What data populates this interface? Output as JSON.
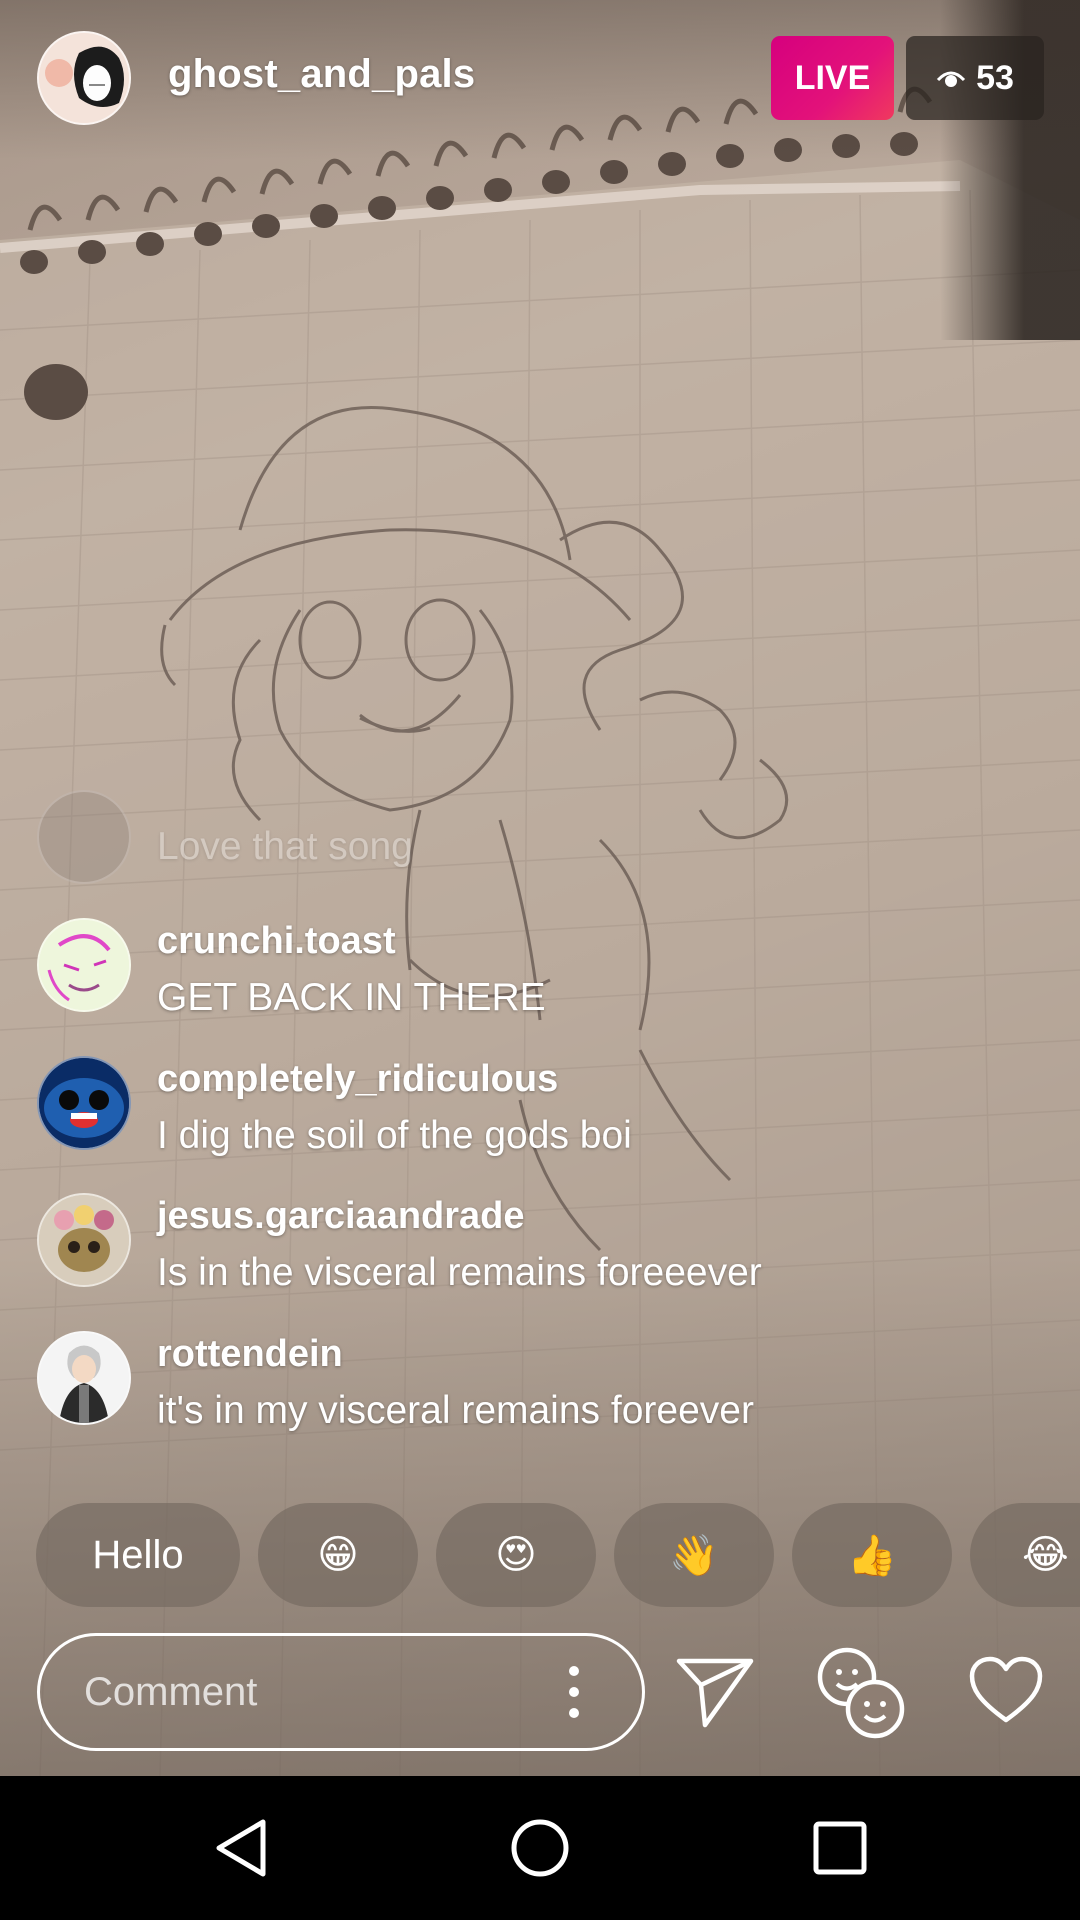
{
  "header": {
    "host_username": "ghost_and_pals",
    "live_label": "LIVE",
    "viewer_count": "53"
  },
  "comments": [
    {
      "username": "",
      "text": "Love that song"
    },
    {
      "username": "crunchi.toast",
      "text": "GET BACK IN THERE"
    },
    {
      "username": "completely_ridiculous",
      "text": "I dig the soil of the gods boi"
    },
    {
      "username": "jesus.garciaandrade",
      "text": "Is in the visceral remains foreeever"
    },
    {
      "username": "rottendein",
      "text": "it's in my visceral remains foreever"
    }
  ],
  "quick_replies": [
    "Hello",
    "😁",
    "😍",
    "👋",
    "👍",
    "😂"
  ],
  "comment_bar": {
    "placeholder": "Comment"
  },
  "colors": {
    "live_badge": "#e3127a",
    "text": "#ffffff"
  },
  "icons": {
    "viewer": "eye-icon",
    "send": "paper-plane-icon",
    "face_filter": "faces-icon",
    "like": "heart-icon",
    "more": "more-vertical-icon",
    "nav_back": "triangle-back-icon",
    "nav_home": "circle-home-icon",
    "nav_recents": "square-recents-icon"
  }
}
